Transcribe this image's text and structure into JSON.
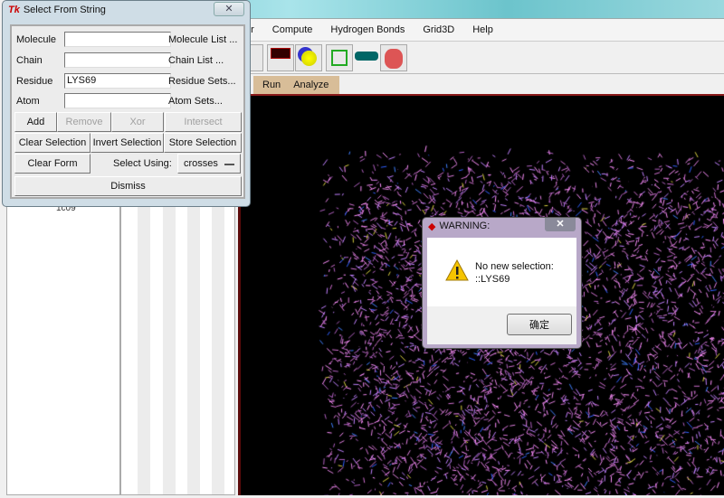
{
  "main": {
    "menu": [
      "or",
      "Compute",
      "Hydrogen Bonds",
      "Grid3D",
      "Help"
    ],
    "tabs": [
      "Run",
      "Analyze"
    ],
    "tree_item": "1c09"
  },
  "dialog": {
    "title": "Select From String",
    "close": "✕",
    "fields": [
      {
        "label": "Molecule",
        "value": "",
        "link": "Molecule List ..."
      },
      {
        "label": "Chain",
        "value": "",
        "link": "Chain List ..."
      },
      {
        "label": "Residue",
        "value": "LYS69",
        "link": "Residue Sets..."
      },
      {
        "label": "Atom",
        "value": "",
        "link": "Atom Sets..."
      }
    ],
    "buttons": {
      "add": "Add",
      "remove": "Remove",
      "xor": "Xor",
      "intersect": "Intersect",
      "clear_selection": "Clear Selection",
      "invert_selection": "Invert Selection",
      "store_selection": "Store Selection",
      "clear_form": "Clear Form",
      "dismiss": "Dismiss"
    },
    "select_using_label": "Select Using:",
    "select_using_value": "crosses"
  },
  "warning": {
    "title": "WARNING:",
    "close": "✕",
    "line1": "No new selection:",
    "line2": "::LYS69",
    "ok": "确定"
  }
}
